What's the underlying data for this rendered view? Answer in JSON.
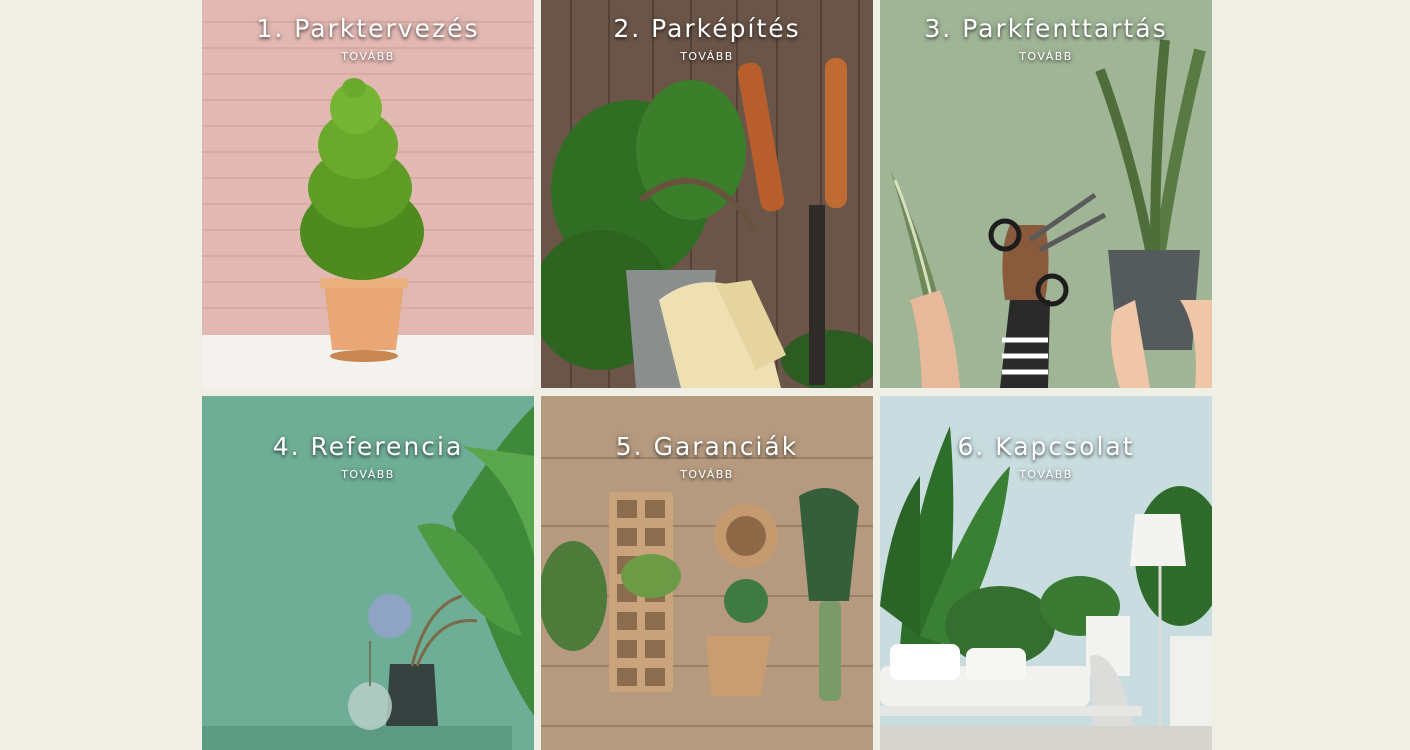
{
  "tiles": [
    {
      "title": "1. Parktervezés",
      "more": "TOVÁBB",
      "image": "potted-topiary-pink-brick-wall"
    },
    {
      "title": "2. Parképítés",
      "more": "TOVÁBB",
      "image": "garden-tools-gloves-wooden-fence"
    },
    {
      "title": "3. Parkfenttartás",
      "more": "TOVÁBB",
      "image": "hands-scissors-snake-plant"
    },
    {
      "title": "4. Referencia",
      "more": "TOVÁBB",
      "image": "green-wall-vases-banana-leaves"
    },
    {
      "title": "5. Garanciák",
      "more": "TOVÁBB",
      "image": "seedling-trays-trowel-wooden-table"
    },
    {
      "title": "6. Kapcsolat",
      "more": "TOVÁBB",
      "image": "living-room-tropical-plants-sofa"
    }
  ],
  "colors": {
    "page_background": "#f0efe5",
    "caption_text": "#ffffff"
  }
}
